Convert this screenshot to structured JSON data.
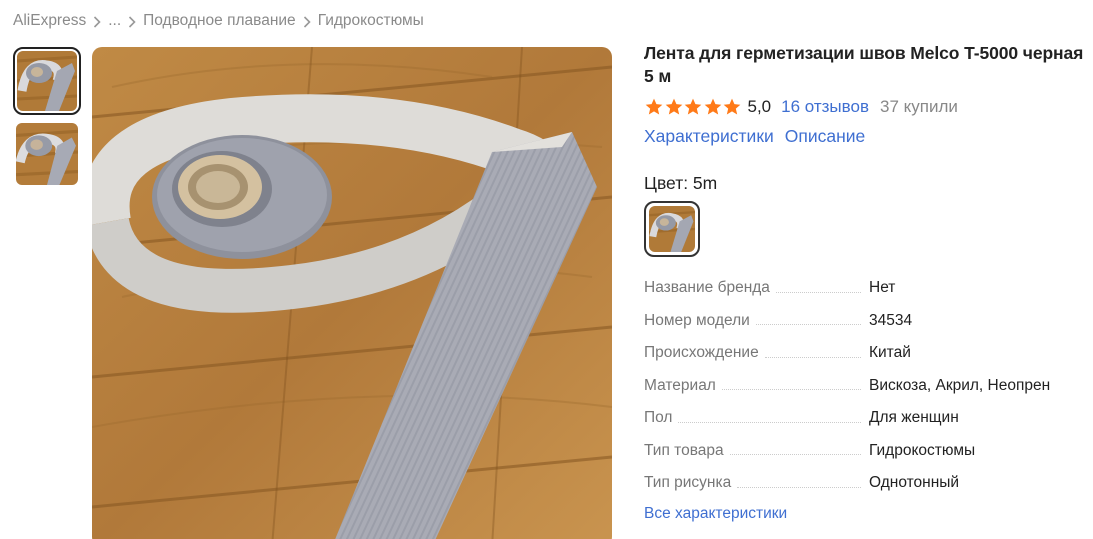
{
  "breadcrumb": {
    "items": [
      "AliExpress",
      "...",
      "Подводное плавание",
      "Гидрокостюмы"
    ]
  },
  "product": {
    "title": "Лента для герметизации швов Melco T-5000 черная 5 м",
    "rating": "5,0",
    "stars": 5,
    "reviews": "16 отзывов",
    "bought": "37 купили",
    "tabs": [
      "Характеристики",
      "Описание"
    ],
    "color_label": "Цвет: 5m"
  },
  "specs": [
    {
      "key": "Название бренда",
      "value": "Нет"
    },
    {
      "key": "Номер модели",
      "value": "34534"
    },
    {
      "key": "Происхождение",
      "value": "Китай"
    },
    {
      "key": "Материал",
      "value": "Вискоза, Акрил, Неопрен"
    },
    {
      "key": "Пол",
      "value": "Для женщин"
    },
    {
      "key": "Тип товара",
      "value": "Гидрокостюмы"
    },
    {
      "key": "Тип рисунка",
      "value": "Однотонный"
    }
  ],
  "all_specs_link": "Все характеристики",
  "colors": {
    "link": "#3f6fd1",
    "star": "#ff7a18",
    "text": "#222222",
    "muted": "#888888"
  }
}
